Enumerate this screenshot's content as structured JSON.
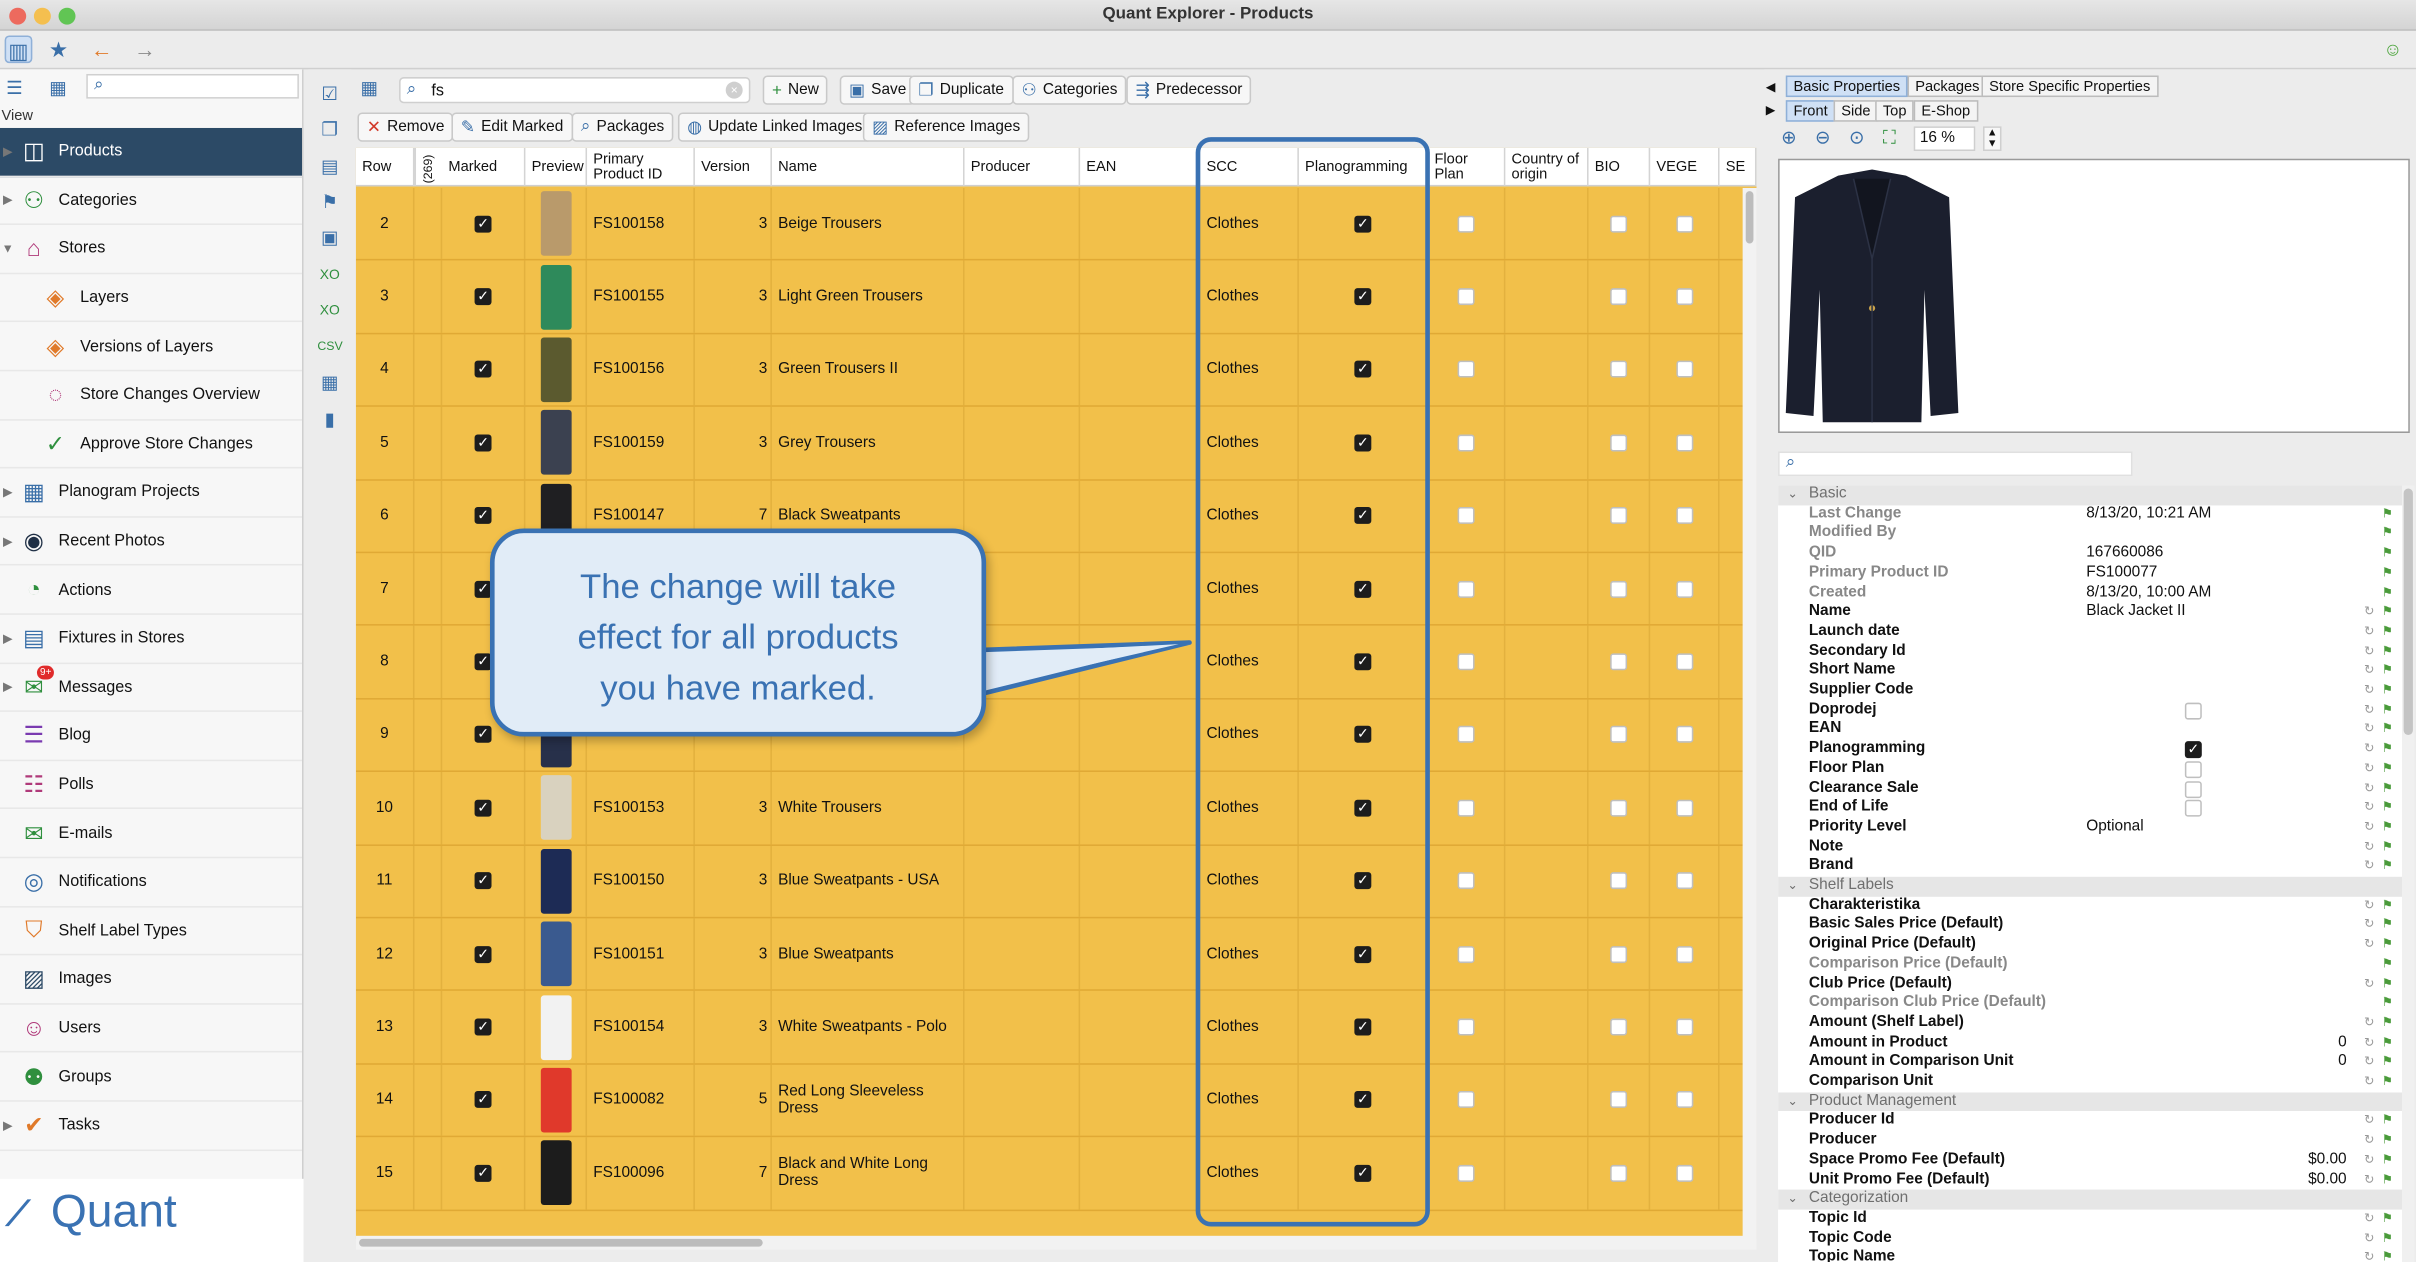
{
  "window": {
    "title": "Quant Explorer - Products"
  },
  "sidebar": {
    "view_label": "View",
    "logo_text": "Quant",
    "items": [
      {
        "label": "Products",
        "icon": "products-icon",
        "active": true
      },
      {
        "label": "Categories",
        "icon": "categories-icon"
      },
      {
        "label": "Stores",
        "icon": "stores-icon"
      },
      {
        "label": "Layers",
        "icon": "layers-icon"
      },
      {
        "label": "Versions of Layers",
        "icon": "layers-versions-icon"
      },
      {
        "label": "Store Changes Overview",
        "icon": "store-changes-icon"
      },
      {
        "label": "Approve Store Changes",
        "icon": "approve-icon"
      },
      {
        "label": "Planogram Projects",
        "icon": "planogram-icon"
      },
      {
        "label": "Recent Photos",
        "icon": "camera-icon"
      },
      {
        "label": "Actions",
        "icon": "actions-icon"
      },
      {
        "label": "Fixtures in Stores",
        "icon": "fixtures-icon"
      },
      {
        "label": "Messages",
        "icon": "messages-icon",
        "badge": "9+"
      },
      {
        "label": "Blog",
        "icon": "blog-icon"
      },
      {
        "label": "Polls",
        "icon": "polls-icon"
      },
      {
        "label": "E-mails",
        "icon": "email-icon"
      },
      {
        "label": "Notifications",
        "icon": "notifications-icon"
      },
      {
        "label": "Shelf Label Types",
        "icon": "shelf-label-icon"
      },
      {
        "label": "Images",
        "icon": "images-icon"
      },
      {
        "label": "Users",
        "icon": "users-icon"
      },
      {
        "label": "Groups",
        "icon": "groups-icon"
      },
      {
        "label": "Tasks",
        "icon": "tasks-icon"
      }
    ]
  },
  "search": {
    "value": "fs"
  },
  "toolbar": {
    "new": "New",
    "save": "Save",
    "duplicate": "Duplicate",
    "categories": "Categories",
    "predecessor": "Predecessor",
    "remove": "Remove",
    "edit_marked": "Edit Marked",
    "packages": "Packages",
    "update_linked_images": "Update Linked Images",
    "reference_images": "Reference Images"
  },
  "table": {
    "count": "(269)",
    "headers": {
      "row": "Row",
      "marked": "Marked",
      "preview": "Preview",
      "primary_id": "Primary Product ID",
      "version": "Version",
      "name": "Name",
      "producer": "Producer",
      "ean": "EAN",
      "scc": "SCC",
      "planogramming": "Planogramming",
      "floor_plan": "Floor Plan",
      "country": "Country of origin",
      "bio": "BIO",
      "vege": "VEGE",
      "se": "SE"
    },
    "rows": [
      {
        "row": "2",
        "id": "FS100158",
        "version": "3",
        "name": "Beige Trousers",
        "scc": "Clothes",
        "color": "#b99a6b"
      },
      {
        "row": "3",
        "id": "FS100155",
        "version": "3",
        "name": "Light Green Trousers",
        "scc": "Clothes",
        "color": "#2e8a5b"
      },
      {
        "row": "4",
        "id": "FS100156",
        "version": "3",
        "name": "Green Trousers II",
        "scc": "Clothes",
        "color": "#5b5a2f"
      },
      {
        "row": "5",
        "id": "FS100159",
        "version": "3",
        "name": "Grey Trousers",
        "scc": "Clothes",
        "color": "#3b4150"
      },
      {
        "row": "6",
        "id": "FS100147",
        "version": "7",
        "name": "Black Sweatpants",
        "scc": "Clothes",
        "color": "#1f1f22"
      },
      {
        "row": "7",
        "id": "",
        "version": "",
        "name": "",
        "scc": "Clothes",
        "color": "#2c2c30"
      },
      {
        "row": "8",
        "id": "",
        "version": "",
        "name": "",
        "scc": "Clothes",
        "color": "#2b3346"
      },
      {
        "row": "9",
        "id": "",
        "version": "",
        "name": "",
        "scc": "Clothes",
        "color": "#27304a"
      },
      {
        "row": "10",
        "id": "FS100153",
        "version": "3",
        "name": "White Trousers",
        "scc": "Clothes",
        "color": "#d9d2bf"
      },
      {
        "row": "11",
        "id": "FS100150",
        "version": "3",
        "name": "Blue Sweatpants - USA",
        "scc": "Clothes",
        "color": "#1d2b55"
      },
      {
        "row": "12",
        "id": "FS100151",
        "version": "3",
        "name": "Blue Sweatpants",
        "scc": "Clothes",
        "color": "#3a5a8f"
      },
      {
        "row": "13",
        "id": "FS100154",
        "version": "3",
        "name": "White Sweatpants - Polo",
        "scc": "Clothes",
        "color": "#f2f2f2"
      },
      {
        "row": "14",
        "id": "FS100082",
        "version": "5",
        "name": "Red Long Sleeveless Dress",
        "scc": "Clothes",
        "color": "#e0392b"
      },
      {
        "row": "15",
        "id": "FS100096",
        "version": "7",
        "name": "Black and White Long Dress",
        "scc": "Clothes",
        "color": "#1c1c1c"
      }
    ]
  },
  "callout": {
    "line1": "The change will take",
    "line2": "effect for all products",
    "line3": "you have marked."
  },
  "right_panel": {
    "tabs": [
      "Basic Properties",
      "Packages",
      "Store Specific Properties"
    ],
    "subtabs": [
      "Front",
      "Side",
      "Top",
      "E-Shop"
    ],
    "zoom": "16 %",
    "properties": [
      {
        "type": "header",
        "label": "Basic"
      },
      {
        "key": "Last Change",
        "value": "8/13/20, 10:21 AM",
        "dim": true
      },
      {
        "key": "Modified By",
        "value": "",
        "dim": true
      },
      {
        "key": "QID",
        "value": "167660086",
        "dim": true
      },
      {
        "key": "Primary Product ID",
        "value": "FS100077",
        "dim": true
      },
      {
        "key": "Created",
        "value": "8/13/20, 10:00 AM",
        "dim": true
      },
      {
        "key": "Name",
        "value": "Black Jacket II"
      },
      {
        "key": "Launch date",
        "value": ""
      },
      {
        "key": "Secondary Id",
        "value": ""
      },
      {
        "key": "Short Name",
        "value": ""
      },
      {
        "key": "Supplier Code",
        "value": ""
      },
      {
        "key": "Doprodej",
        "check": "off"
      },
      {
        "key": "EAN",
        "value": ""
      },
      {
        "key": "Planogramming",
        "check": "on"
      },
      {
        "key": "Floor Plan",
        "check": "off"
      },
      {
        "key": "Clearance Sale",
        "check": "off"
      },
      {
        "key": "End of Life",
        "check": "off"
      },
      {
        "key": "Priority Level",
        "value": "Optional"
      },
      {
        "key": "Note",
        "value": ""
      },
      {
        "key": "Brand",
        "value": ""
      },
      {
        "type": "header",
        "label": "Shelf Labels"
      },
      {
        "key": "Charakteristika",
        "value": ""
      },
      {
        "key": "Basic Sales Price (Default)",
        "value": ""
      },
      {
        "key": "Original Price (Default)",
        "value": ""
      },
      {
        "key": "Comparison Price (Default)",
        "value": "",
        "dim": true
      },
      {
        "key": "Club Price (Default)",
        "value": ""
      },
      {
        "key": "Comparison Club Price (Default)",
        "value": "",
        "dim": true
      },
      {
        "key": "Amount (Shelf Label)",
        "value": ""
      },
      {
        "key": "Amount in Product",
        "right": "0"
      },
      {
        "key": "Amount in Comparison Unit",
        "right": "0"
      },
      {
        "key": "Comparison Unit",
        "value": ""
      },
      {
        "type": "header",
        "label": "Product Management"
      },
      {
        "key": "Producer Id",
        "value": ""
      },
      {
        "key": "Producer",
        "value": ""
      },
      {
        "key": "Space Promo Fee (Default)",
        "right": "$0.00"
      },
      {
        "key": "Unit Promo Fee (Default)",
        "right": "$0.00"
      },
      {
        "type": "header",
        "label": "Categorization"
      },
      {
        "key": "Topic Id",
        "value": ""
      },
      {
        "key": "Topic Code",
        "value": ""
      },
      {
        "key": "Topic Name",
        "value": ""
      }
    ]
  }
}
